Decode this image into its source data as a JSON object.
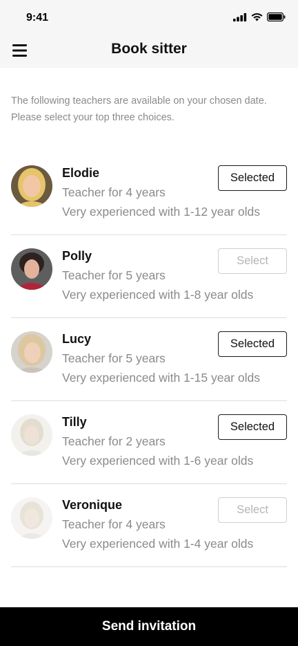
{
  "status_bar": {
    "time": "9:41",
    "icons": [
      "signal-icon",
      "wifi-icon",
      "battery-icon"
    ]
  },
  "header": {
    "title": "Book sitter",
    "menu_icon": "hamburger-menu-icon"
  },
  "intro_text": "The following teachers are available on your chosen date. Please select your top three choices.",
  "teachers": [
    {
      "name": "Elodie",
      "experience": "Teacher for 4 years",
      "specialty": "Very experienced with 1-12 year olds",
      "button": "Selected",
      "selected": true
    },
    {
      "name": "Polly",
      "experience": "Teacher for 5 years",
      "specialty": "Very experienced with 1-8 year olds",
      "button": "Select",
      "selected": false
    },
    {
      "name": "Lucy",
      "experience": "Teacher for 5 years",
      "specialty": "Very experienced with 1-15 year olds",
      "button": "Selected",
      "selected": true
    },
    {
      "name": "Tilly",
      "experience": "Teacher for 2 years",
      "specialty": "Very experienced with 1-6 year olds",
      "button": "Selected",
      "selected": true
    },
    {
      "name": "Veronique",
      "experience": "Teacher for 4 years",
      "specialty": "Very experienced with 1-4 year olds",
      "button": "Select",
      "selected": false
    }
  ],
  "cta": {
    "label": "Send invitation"
  },
  "colors": {
    "accent": "#000000",
    "muted_text": "#8a8a8a",
    "divider": "#dcdcdc"
  }
}
